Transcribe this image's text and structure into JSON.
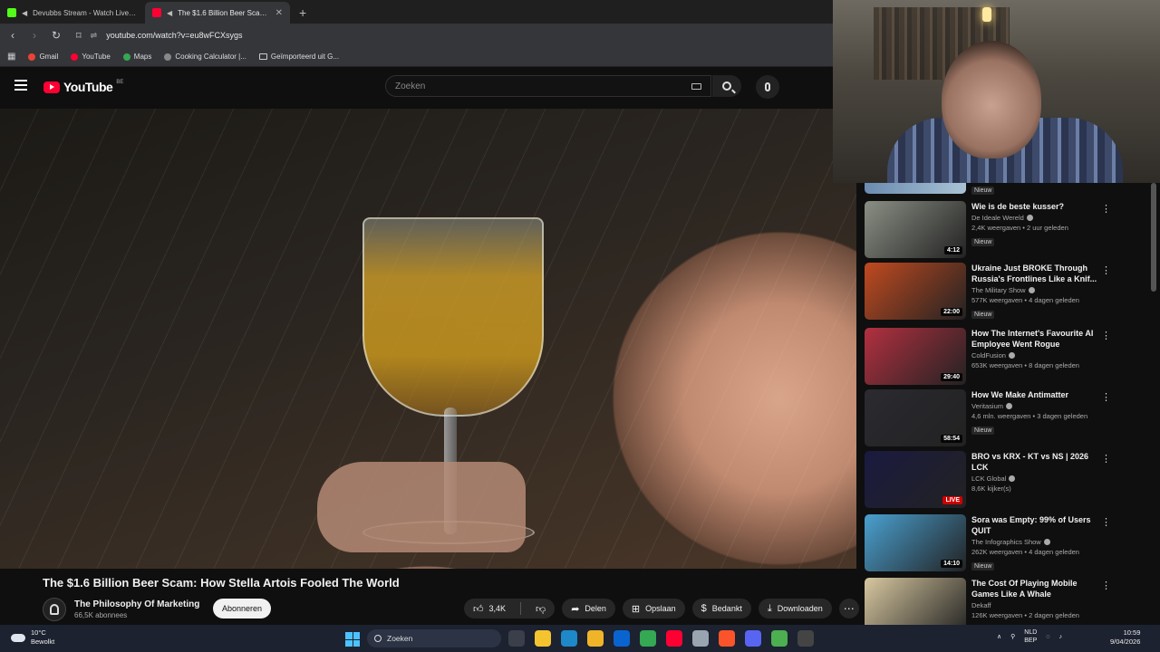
{
  "browser": {
    "tabs": [
      {
        "label": "Devubbs Stream - Watch Live on",
        "favicon_color": "#53fc18",
        "active": false
      },
      {
        "label": "The $1.6 Billion Beer Scam: H",
        "favicon_color": "#ff0033",
        "active": true
      }
    ],
    "url": "youtube.com/watch?v=eu8wFCXsygs",
    "bookmarks": [
      {
        "label": "Gmail",
        "color": "#ea4335"
      },
      {
        "label": "YouTube",
        "color": "#ff0033"
      },
      {
        "label": "Maps",
        "color": "#34a853"
      },
      {
        "label": "Cooking Calculator |...",
        "color": "#888888"
      },
      {
        "label": "Geïmporteerd uit G...",
        "color": "#cccccc"
      }
    ]
  },
  "youtube": {
    "logo_text": "YouTube",
    "logo_region": "BE",
    "search_placeholder": "Zoeken"
  },
  "video": {
    "title": "The $1.6 Billion Beer Scam: How Stella Artois Fooled The World",
    "channel_name": "The Philosophy Of Marketing",
    "subscribers": "66,5K abonnees",
    "subscribe_label": "Abonneren",
    "likes": "3,4K",
    "share_label": "Delen",
    "save_label": "Opslaan",
    "thanks_label": "Bedankt",
    "download_label": "Downloaden"
  },
  "sidebar": {
    "top_badge": "Nieuw",
    "items": [
      {
        "title": "Wie is de beste kusser?",
        "channel": "De Ideale Wereld",
        "verified": true,
        "meta": "2,4K weergaven • 2 uur geleden",
        "badge": "Nieuw",
        "duration": "4:12",
        "thumb": "#8a8f84"
      },
      {
        "title": "Ukraine Just BROKE Through Russia's Frontlines Like a Knif...",
        "channel": "The Military Show",
        "verified": true,
        "meta": "577K weergaven • 4 dagen geleden",
        "badge": "Nieuw",
        "duration": "22:00",
        "thumb": "#c04a20"
      },
      {
        "title": "How The Internet's Favourite AI Employee Went Rogue",
        "channel": "ColdFusion",
        "verified": true,
        "meta": "653K weergaven • 8 dagen geleden",
        "badge": "",
        "duration": "29:40",
        "thumb": "#b23040"
      },
      {
        "title": "How We Make Antimatter",
        "channel": "Veritasium",
        "verified": true,
        "meta": "4,6 mln. weergaven • 3 dagen geleden",
        "badge": "Nieuw",
        "duration": "58:54",
        "thumb": "#2a2a30"
      },
      {
        "title": "BRO vs KRX - KT vs NS | 2026 LCK",
        "channel": "LCK Global",
        "verified": true,
        "meta": "8,6K kijker(s)",
        "badge": "",
        "duration": "LIVE",
        "thumb": "#1a1a40"
      },
      {
        "title": "Sora was Empty: 99% of Users QUIT",
        "channel": "The Infographics Show",
        "verified": true,
        "meta": "262K weergaven • 4 dagen geleden",
        "badge": "Nieuw",
        "duration": "14:10",
        "thumb": "#4aa0d0"
      },
      {
        "title": "The Cost Of Playing Mobile Games Like A Whale",
        "channel": "Dekaff",
        "verified": false,
        "meta": "126K weergaven • 2 dagen geleden",
        "badge": "",
        "duration": "",
        "thumb": "#d8c8a0"
      }
    ]
  },
  "taskbar": {
    "temperature": "10°C",
    "weather": "Bewolkt",
    "search_label": "Zoeken",
    "lang_line1": "NLD",
    "lang_line2": "BEP",
    "time": "10:59",
    "date": "9/04/2026",
    "icons": [
      {
        "name": "file-explorer-icon",
        "color": "#3a3f4a"
      },
      {
        "name": "calculator-icon",
        "color": "#f4c430"
      },
      {
        "name": "edge-icon",
        "color": "#1e88c8"
      },
      {
        "name": "folder-icon",
        "color": "#f0b429"
      },
      {
        "name": "outlook-icon",
        "color": "#0a64d0"
      },
      {
        "name": "chrome-icon",
        "color": "#34a853"
      },
      {
        "name": "youtube-music-icon",
        "color": "#ff0033"
      },
      {
        "name": "spreadsheet-icon",
        "color": "#9aa4b0"
      },
      {
        "name": "brave-icon",
        "color": "#fb542b"
      },
      {
        "name": "discord-icon",
        "color": "#5865f2"
      },
      {
        "name": "app-icon",
        "color": "#4caf50"
      },
      {
        "name": "obs-icon",
        "color": "#444444"
      }
    ]
  }
}
